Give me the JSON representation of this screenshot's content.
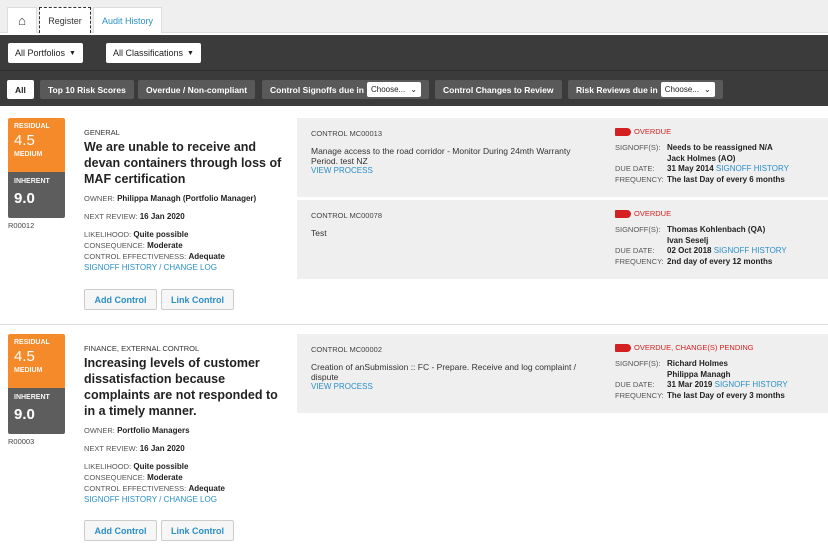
{
  "tabs": {
    "home_icon": "home-icon",
    "register": "Register",
    "audit_history": "Audit History"
  },
  "filters": {
    "portfolios": "All Portfolios",
    "classifications": "All Classifications"
  },
  "pills": {
    "all": "All",
    "top10": "Top 10 Risk Scores",
    "overdue": "Overdue / Non-compliant",
    "signoffs": "Control Signoffs due in",
    "signoffs_select": "Choose...",
    "changes": "Control Changes to Review",
    "reviews": "Risk Reviews due in",
    "reviews_select": "Choose..."
  },
  "labels": {
    "residual": "RESIDUAL",
    "inherent": "INHERENT",
    "owner": "OWNER:",
    "next_review": "NEXT REVIEW:",
    "likelihood": "LIKELIHOOD:",
    "consequence": "CONSEQUENCE:",
    "effectiveness": "CONTROL EFFECTIVENESS:",
    "signoff_history": "SIGNOFF HISTORY",
    "slash": " / ",
    "change_log": "CHANGE LOG",
    "add_control": "Add Control",
    "link_control": "Link Control",
    "signoffs": "SIGNOFF(S):",
    "due_date": "DUE DATE:",
    "frequency": "FREQUENCY:",
    "view_process": "VIEW PROCESS"
  },
  "colors": {
    "residual": "#f58a2a",
    "inherent": "#5d5d5d",
    "overdue": "#d42020",
    "link": "#2a8fc7"
  },
  "risks": [
    {
      "id": "R00012",
      "residual": "4.5",
      "residual_level": "MEDIUM",
      "inherent": "9.0",
      "category": "GENERAL",
      "title": "We are unable to receive and devan containers through loss of MAF certification",
      "owner": "Philippa Managh (Portfolio Manager)",
      "next_review": "16 Jan 2020",
      "likelihood": "Quite possible",
      "consequence": "Moderate",
      "effectiveness": "Adequate",
      "controls": [
        {
          "id": "CONTROL MC00013",
          "desc": "Manage access to the road corridor - Monitor During 24mth Warranty Period. test NZ",
          "view_process": true,
          "status": "OVERDUE",
          "signoffs": [
            "Needs to be reassigned N/A",
            "Jack Holmes (AO)"
          ],
          "due": "31 May 2014",
          "frequency": "The last Day of every 6 months"
        },
        {
          "id": "CONTROL MC00078",
          "desc": "Test",
          "view_process": false,
          "status": "OVERDUE",
          "signoffs": [
            "Thomas Kohlenbach (QA)",
            "Ivan Seselj"
          ],
          "due": "02 Oct 2018",
          "frequency": "2nd day of every 12 months"
        }
      ]
    },
    {
      "id": "R00003",
      "residual": "4.5",
      "residual_level": "MEDIUM",
      "inherent": "9.0",
      "category": "FINANCE, EXTERNAL CONTROL",
      "title": "Increasing levels of customer dissatisfaction because complaints are not responded to in a timely manner.",
      "owner": "Portfolio Managers",
      "next_review": "16 Jan 2020",
      "likelihood": "Quite possible",
      "consequence": "Moderate",
      "effectiveness": "Adequate",
      "controls": [
        {
          "id": "CONTROL MC00002",
          "desc": "Creation of anSubmission :: FC - Prepare. Receive and log complaint / dispute",
          "view_process": true,
          "status": "OVERDUE, CHANGE(S) PENDING",
          "signoffs": [
            "Richard Holmes",
            "Philippa Managh"
          ],
          "due": "31 Mar 2019",
          "frequency": "The last Day of every 3 months"
        }
      ]
    }
  ]
}
